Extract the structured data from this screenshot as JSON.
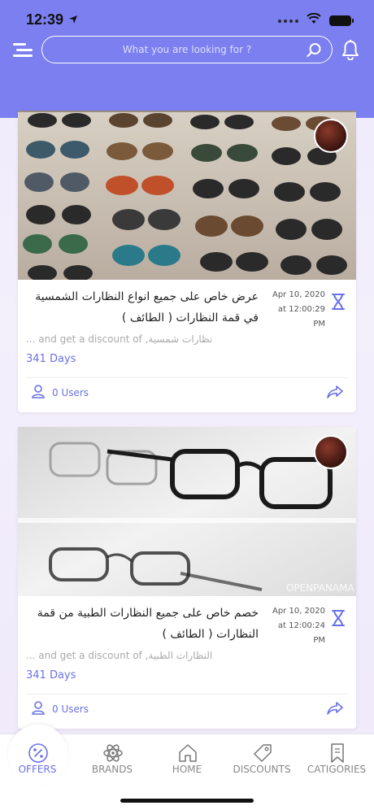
{
  "status_bar": {
    "time": "12:39"
  },
  "search": {
    "placeholder": "What you are looking for ?"
  },
  "offers": [
    {
      "title": "عرض خاص على جميع انواع النظارات الشمسية في قمة النظارات ( الطائف )",
      "date": "Apr 10, 2020",
      "time": "at 12:00:29 PM",
      "description": "... and get  a discount of  ,نظارات شمسية",
      "duration": "341 Days",
      "users": "0  Users"
    },
    {
      "title": "خصم خاص على جميع النظارات الطبية من قمة النظارات ( الطائف )",
      "date": "Apr 10, 2020",
      "time": "at 12:00:24 PM",
      "description": "... and get  a discount of  ,النظارات الطبية",
      "duration": "341 Days",
      "users": "0  Users"
    }
  ],
  "tabs": [
    {
      "label": "OFFERS",
      "icon": "percent-icon",
      "active": true
    },
    {
      "label": "BRANDS",
      "icon": "atom-icon"
    },
    {
      "label": "HOME",
      "icon": "home-icon"
    },
    {
      "label": "DISCOUNTS",
      "icon": "tag-icon"
    },
    {
      "label": "CATIGORIES",
      "icon": "bookmark-icon"
    }
  ],
  "colors": {
    "header": "#7b7ff0",
    "accent": "#6a70e8"
  }
}
